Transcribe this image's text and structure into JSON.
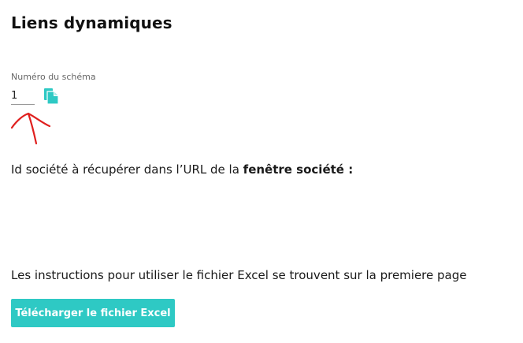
{
  "page": {
    "title": "Liens dynamiques"
  },
  "schema_field": {
    "label": "Numéro du schéma",
    "value": "1",
    "copy_icon": "copy-icon"
  },
  "company_line": {
    "text_prefix": "Id société à récupérer dans l’URL de la ",
    "text_bold": "fenêtre société :"
  },
  "instructions": {
    "text": "Les instructions pour utiliser le fichier Excel se trouvent sur la premiere page"
  },
  "download_button": {
    "label": "Télécharger le fichier Excel"
  },
  "colors": {
    "accent": "#2ec9c4",
    "annotation": "#e0201f"
  }
}
